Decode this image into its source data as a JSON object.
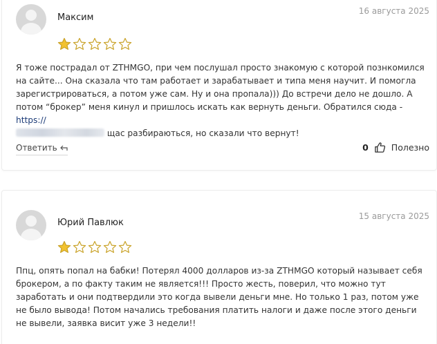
{
  "colors": {
    "star_filled": "#f2c230",
    "star_outline": "#c9a227",
    "avatar_bg": "#d8d8d8",
    "link": "#1d3c78"
  },
  "reviews": [
    {
      "author": "Максим",
      "date": "16 августа 2025",
      "rating": 1,
      "rating_max": 5,
      "text_part1": "Я тоже пострадал от ZTHMGO, при чем послушал просто знакомую с которой познкомился на сайте... Она сказала что там работает и зарабатывает и типа меня научит. И помогла зарегистрироваться, а потом уже сам. Ну и она пропала))) До встречи дело не дошло. А потом “брокер” меня кинул и пришлось искать как вернуть деньги. Обратился сюда - ",
      "link_text": "https://",
      "text_part2": " щас разбираються, но сказали что вернут!",
      "reply_label": "Ответить",
      "helpful_count": "0",
      "helpful_label": "Полезно"
    },
    {
      "author": "Юрий Павлюк",
      "date": "15 августа 2025",
      "rating": 1,
      "rating_max": 5,
      "text": "Ппц, опять попал на бабки! Потерял 4000 долларов из-за ZTHMGO который называет себя брокером, а по факту таким не является!!! Просто жесть, поверил, что можно тут заработать и они подтвердили это когда вывели деньги мне. Но только 1 раз, потом уже не было вывода! Потом начались требования платить налоги и даже после этого деньги не вывели, заявка висит уже 3 недели!!"
    }
  ]
}
